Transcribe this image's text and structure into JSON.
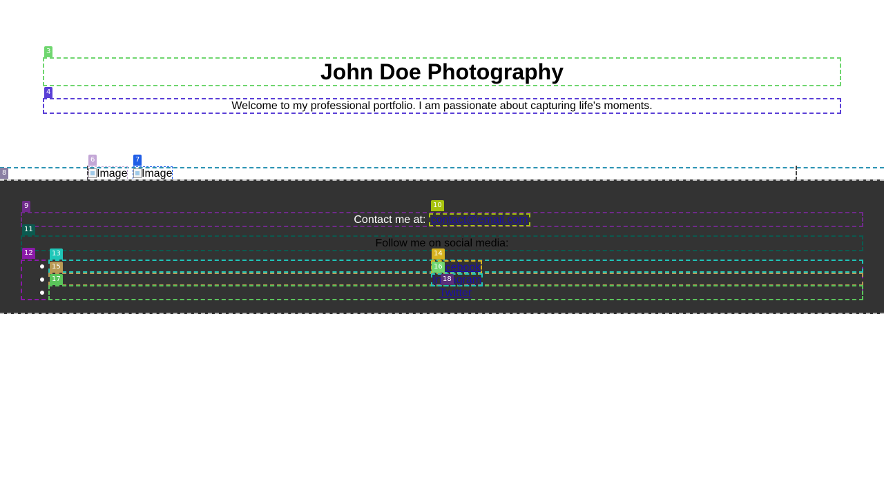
{
  "header": {
    "title": "John Doe Photography",
    "subtitle": "Welcome to my professional portfolio. I am passionate about capturing life's moments."
  },
  "gallery": {
    "images": [
      {
        "alt": "Image"
      },
      {
        "alt": "Image"
      }
    ]
  },
  "footer": {
    "contact_prefix": "Contact me at:",
    "contact_email": "contact@email.com",
    "follow_text": "Follow me on social media:",
    "social_links": [
      {
        "label": "Facebook"
      },
      {
        "label": "Instagram"
      },
      {
        "label": "Twitter"
      }
    ]
  },
  "som_labels": [
    "3",
    "4",
    "6",
    "7",
    "8",
    "9",
    "10",
    "11",
    "12",
    "13",
    "14",
    "15",
    "16",
    "17",
    "18"
  ]
}
